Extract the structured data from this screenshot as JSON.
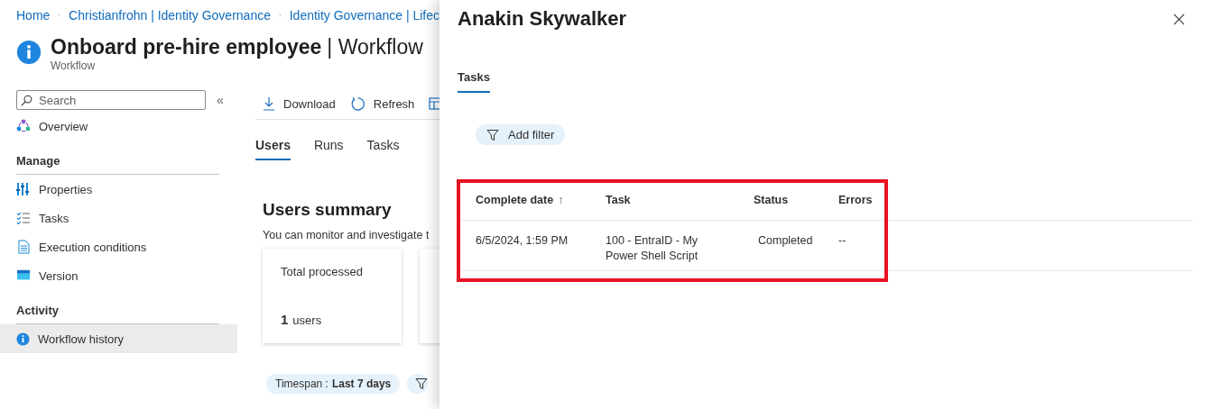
{
  "breadcrumb": [
    "Home",
    "Christianfrohn | Identity Governance",
    "Identity Governance | Lifec"
  ],
  "page": {
    "title": "Onboard pre-hire employee",
    "title_suffix": "| Workflow",
    "subtitle": "Workflow"
  },
  "sidebar": {
    "search": {
      "placeholder": "Search"
    },
    "collapse": "«",
    "top_items": [
      {
        "label": "Overview",
        "selected": false
      }
    ],
    "sections": [
      {
        "heading": "Manage",
        "items": [
          {
            "label": "Properties",
            "selected": false
          },
          {
            "label": "Tasks",
            "selected": false
          },
          {
            "label": "Execution conditions",
            "selected": false
          },
          {
            "label": "Version",
            "selected": false
          }
        ]
      },
      {
        "heading": "Activity",
        "items": [
          {
            "label": "Workflow history",
            "selected": true
          }
        ]
      }
    ]
  },
  "toolbar": [
    {
      "label": "Download"
    },
    {
      "label": "Refresh"
    }
  ],
  "tabs": [
    {
      "label": "Users",
      "selected": true
    },
    {
      "label": "Runs",
      "selected": false
    },
    {
      "label": "Tasks",
      "selected": false
    }
  ],
  "summary": {
    "title": "Users summary",
    "description": "You can monitor and investigate t",
    "cards": [
      {
        "label": "Total processed",
        "count": "1",
        "unit": "users"
      }
    ]
  },
  "timespan": {
    "label": "Timespan :",
    "value": "Last 7 days"
  },
  "panel": {
    "title": "Anakin Skywalker",
    "tabs": [
      {
        "label": "Tasks",
        "selected": true
      }
    ],
    "add_filter": "Add filter",
    "table": {
      "columns": [
        {
          "label": "Complete date",
          "sort": "↑"
        },
        {
          "label": "Task"
        },
        {
          "label": "Status"
        },
        {
          "label": "Errors"
        }
      ],
      "rows": [
        {
          "cells": [
            "6/5/2024, 1:59 PM",
            "100 - EntraID - My Power Shell Script",
            "Completed",
            "--"
          ]
        }
      ]
    }
  }
}
